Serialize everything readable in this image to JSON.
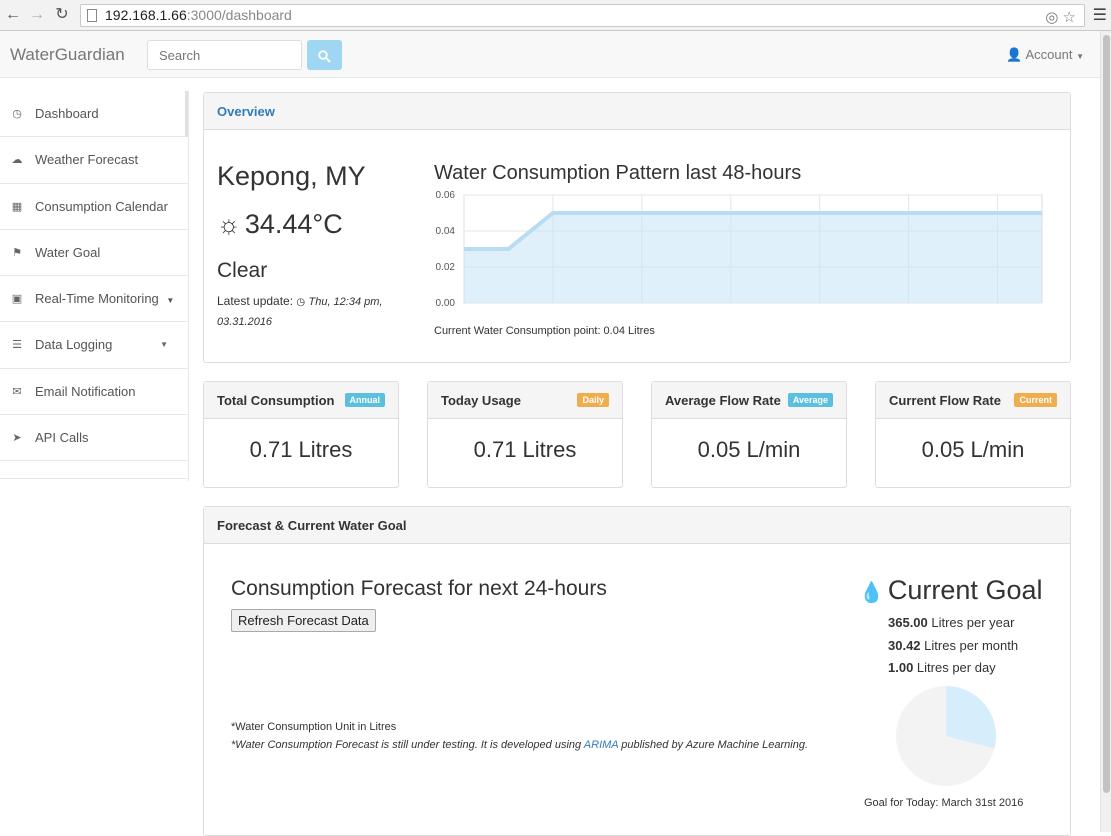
{
  "browser": {
    "url_host": "192.168.1.66",
    "url_rest": ":3000/dashboard"
  },
  "navbar": {
    "brand": "WaterGuardian",
    "search_placeholder": "Search",
    "account": "Account"
  },
  "sidebar": {
    "items": [
      {
        "label": "Dashboard",
        "icon": "dashboard-icon"
      },
      {
        "label": "Weather Forecast",
        "icon": "cloud-icon"
      },
      {
        "label": "Consumption Calendar",
        "icon": "calendar-icon"
      },
      {
        "label": "Water Goal",
        "icon": "flag-icon"
      },
      {
        "label": "Real-Time Monitoring",
        "icon": "monitor-icon"
      },
      {
        "label": "Data Logging",
        "icon": "list-icon"
      },
      {
        "label": "Email Notification",
        "icon": "envelope-icon"
      },
      {
        "label": "API Calls",
        "icon": "send-icon"
      }
    ]
  },
  "overview": {
    "heading": "Overview",
    "location": "Kepong, MY",
    "temperature": "34.44°C",
    "condition": "Clear",
    "latest_label": "Latest update:",
    "latest_time": "Thu, 12:34 pm, 03.31.2016",
    "chart_title": "Water Consumption Pattern last 48-hours",
    "chart_note": "Current Water Consumption point: 0.04 Litres"
  },
  "chart_data": {
    "type": "area",
    "title": "Water Consumption Pattern last 48-hours",
    "yticks": [
      "0.06",
      "0.04",
      "0.02",
      "0.00"
    ],
    "ylim": [
      0,
      0.06
    ],
    "x": [
      0,
      0.5,
      1,
      2,
      3,
      4,
      5,
      6,
      6.5
    ],
    "values": [
      0.03,
      0.03,
      0.05,
      0.05,
      0.05,
      0.05,
      0.05,
      0.05,
      0.05
    ],
    "grid": true,
    "color": "#c5e4f7"
  },
  "stats": [
    {
      "title": "Total Consumption",
      "badge": "Annual",
      "value": "0.71 Litres",
      "color": "#5bc0de"
    },
    {
      "title": "Today Usage",
      "badge": "Daily",
      "value": "0.71 Litres",
      "color": "#f0ad4e"
    },
    {
      "title": "Average Flow Rate",
      "badge": "Average",
      "value": "0.05 L/min",
      "color": "#5bc0de"
    },
    {
      "title": "Current Flow Rate",
      "badge": "Current",
      "value": "0.05 L/min",
      "color": "#f0ad4e"
    }
  ],
  "forecast": {
    "heading": "Forecast & Current Water Goal",
    "title": "Consumption Forecast for next 24-hours",
    "refresh": "Refresh Forecast Data",
    "note1": "*Water Consumption Unit in Litres",
    "note2_a": "*Water Consumption Forecast is still under testing. It is developed using ",
    "note2_link": "ARIMA",
    "note2_b": " published by Azure Machine Learning."
  },
  "goal": {
    "title": "Current Goal",
    "year_value": "365.00",
    "year_label": " Litres per year",
    "month_value": "30.42",
    "month_label": " Litres per month",
    "day_value": "1.00",
    "day_label": " Litres per day",
    "date": "Goal for Today: March 31st 2016",
    "pie_fraction": 0.29
  }
}
